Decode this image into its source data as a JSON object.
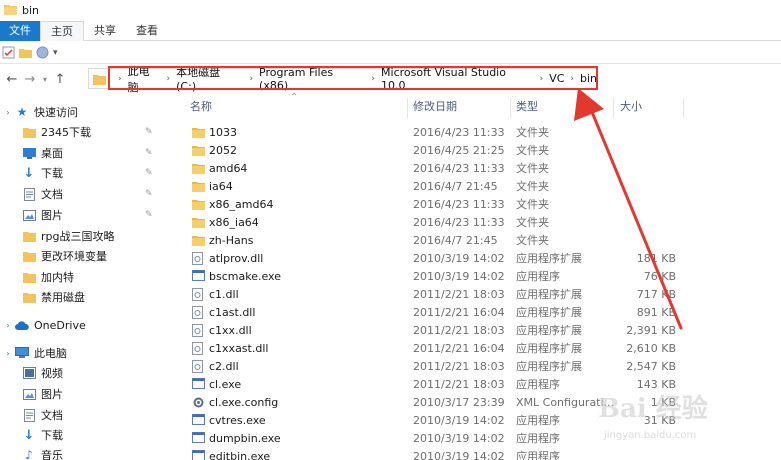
{
  "window": {
    "title": "bin"
  },
  "ribbon": {
    "tabs": [
      "文件",
      "主页",
      "共享",
      "查看"
    ]
  },
  "address": {
    "crumbs": [
      "此电脑",
      "本地磁盘 (C:)",
      "Program Files (x86)",
      "Microsoft Visual Studio 10.0",
      "VC",
      "bin"
    ]
  },
  "sidebar": {
    "quick_access": "快速访问",
    "pinned": [
      {
        "label": "2345下载",
        "icon": "folder-icon"
      },
      {
        "label": "桌面",
        "icon": "desktop-icon"
      },
      {
        "label": "下载",
        "icon": "download-icon"
      },
      {
        "label": "文档",
        "icon": "document-icon"
      },
      {
        "label": "图片",
        "icon": "picture-icon"
      }
    ],
    "folders": [
      "rpg战三国攻略",
      "更改环境变量",
      "加内特",
      "禁用磁盘"
    ],
    "onedrive": "OneDrive",
    "this_pc": "此电脑",
    "pc_items": [
      {
        "label": "视频",
        "icon": "video-icon"
      },
      {
        "label": "图片",
        "icon": "picture-icon"
      },
      {
        "label": "文档",
        "icon": "document-icon"
      },
      {
        "label": "下载",
        "icon": "download-icon"
      },
      {
        "label": "音乐",
        "icon": "music-icon"
      }
    ]
  },
  "columns": {
    "name": "名称",
    "date": "修改日期",
    "type": "类型",
    "size": "大小"
  },
  "files": [
    {
      "name": "1033",
      "date": "2016/4/23 11:33",
      "type": "文件夹",
      "size": "",
      "kind": "folder"
    },
    {
      "name": "2052",
      "date": "2016/4/25 21:25",
      "type": "文件夹",
      "size": "",
      "kind": "folder"
    },
    {
      "name": "amd64",
      "date": "2016/4/23 11:33",
      "type": "文件夹",
      "size": "",
      "kind": "folder"
    },
    {
      "name": "ia64",
      "date": "2016/4/7 21:45",
      "type": "文件夹",
      "size": "",
      "kind": "folder"
    },
    {
      "name": "x86_amd64",
      "date": "2016/4/23 11:33",
      "type": "文件夹",
      "size": "",
      "kind": "folder"
    },
    {
      "name": "x86_ia64",
      "date": "2016/4/23 11:33",
      "type": "文件夹",
      "size": "",
      "kind": "folder"
    },
    {
      "name": "zh-Hans",
      "date": "2016/4/7 21:45",
      "type": "文件夹",
      "size": "",
      "kind": "folder"
    },
    {
      "name": "atlprov.dll",
      "date": "2010/3/19 14:02",
      "type": "应用程序扩展",
      "size": "181 KB",
      "kind": "dll"
    },
    {
      "name": "bscmake.exe",
      "date": "2010/3/19 14:02",
      "type": "应用程序",
      "size": "76 KB",
      "kind": "exe"
    },
    {
      "name": "c1.dll",
      "date": "2011/2/21 18:03",
      "type": "应用程序扩展",
      "size": "717 KB",
      "kind": "dll"
    },
    {
      "name": "c1ast.dll",
      "date": "2011/2/21 16:04",
      "type": "应用程序扩展",
      "size": "891 KB",
      "kind": "dll"
    },
    {
      "name": "c1xx.dll",
      "date": "2011/2/21 18:03",
      "type": "应用程序扩展",
      "size": "2,391 KB",
      "kind": "dll"
    },
    {
      "name": "c1xxast.dll",
      "date": "2011/2/21 16:04",
      "type": "应用程序扩展",
      "size": "2,610 KB",
      "kind": "dll"
    },
    {
      "name": "c2.dll",
      "date": "2011/2/21 18:03",
      "type": "应用程序扩展",
      "size": "2,547 KB",
      "kind": "dll"
    },
    {
      "name": "cl.exe",
      "date": "2011/2/21 18:03",
      "type": "应用程序",
      "size": "143 KB",
      "kind": "exe"
    },
    {
      "name": "cl.exe.config",
      "date": "2010/3/17 23:39",
      "type": "XML Configurati...",
      "size": "1 KB",
      "kind": "config"
    },
    {
      "name": "cvtres.exe",
      "date": "2010/3/19 14:02",
      "type": "应用程序",
      "size": "31 KB",
      "kind": "exe"
    },
    {
      "name": "dumpbin.exe",
      "date": "2010/3/19 14:02",
      "type": "应用程序",
      "size": "",
      "kind": "exe"
    },
    {
      "name": "editbin.exe",
      "date": "2010/3/19 14:02",
      "type": "应用程序",
      "size": "",
      "kind": "exe"
    }
  ],
  "watermark": {
    "brand": "Bai 经验",
    "url": "jingyan.baidu.com"
  },
  "colors": {
    "accent": "#1979ca",
    "folder": "#f2c55c",
    "annotation": "#e03a30"
  }
}
